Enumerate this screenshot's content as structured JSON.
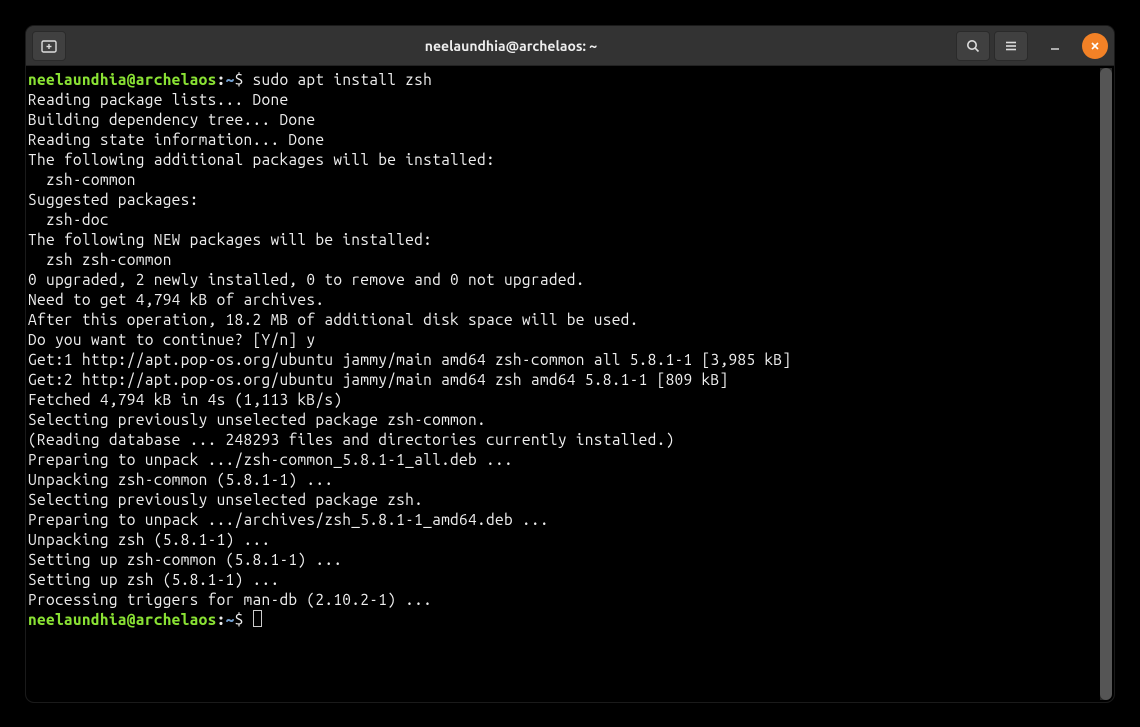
{
  "window": {
    "title": "neelaundhia@archelaos: ~"
  },
  "prompt": {
    "user_host": "neelaundhia@archelaos",
    "colon": ":",
    "path": "~",
    "dollar": "$"
  },
  "command1": " sudo apt install zsh",
  "output_lines": [
    "Reading package lists... Done",
    "Building dependency tree... Done",
    "Reading state information... Done",
    "The following additional packages will be installed:",
    "  zsh-common",
    "Suggested packages:",
    "  zsh-doc",
    "The following NEW packages will be installed:",
    "  zsh zsh-common",
    "0 upgraded, 2 newly installed, 0 to remove and 0 not upgraded.",
    "Need to get 4,794 kB of archives.",
    "After this operation, 18.2 MB of additional disk space will be used.",
    "Do you want to continue? [Y/n] y",
    "Get:1 http://apt.pop-os.org/ubuntu jammy/main amd64 zsh-common all 5.8.1-1 [3,985 kB]",
    "Get:2 http://apt.pop-os.org/ubuntu jammy/main amd64 zsh amd64 5.8.1-1 [809 kB]",
    "Fetched 4,794 kB in 4s (1,113 kB/s)",
    "Selecting previously unselected package zsh-common.",
    "(Reading database ... 248293 files and directories currently installed.)",
    "Preparing to unpack .../zsh-common_5.8.1-1_all.deb ...",
    "Unpacking zsh-common (5.8.1-1) ...",
    "Selecting previously unselected package zsh.",
    "Preparing to unpack .../archives/zsh_5.8.1-1_amd64.deb ...",
    "Unpacking zsh (5.8.1-1) ...",
    "Setting up zsh-common (5.8.1-1) ...",
    "Setting up zsh (5.8.1-1) ...",
    "Processing triggers for man-db (2.10.2-1) ..."
  ]
}
